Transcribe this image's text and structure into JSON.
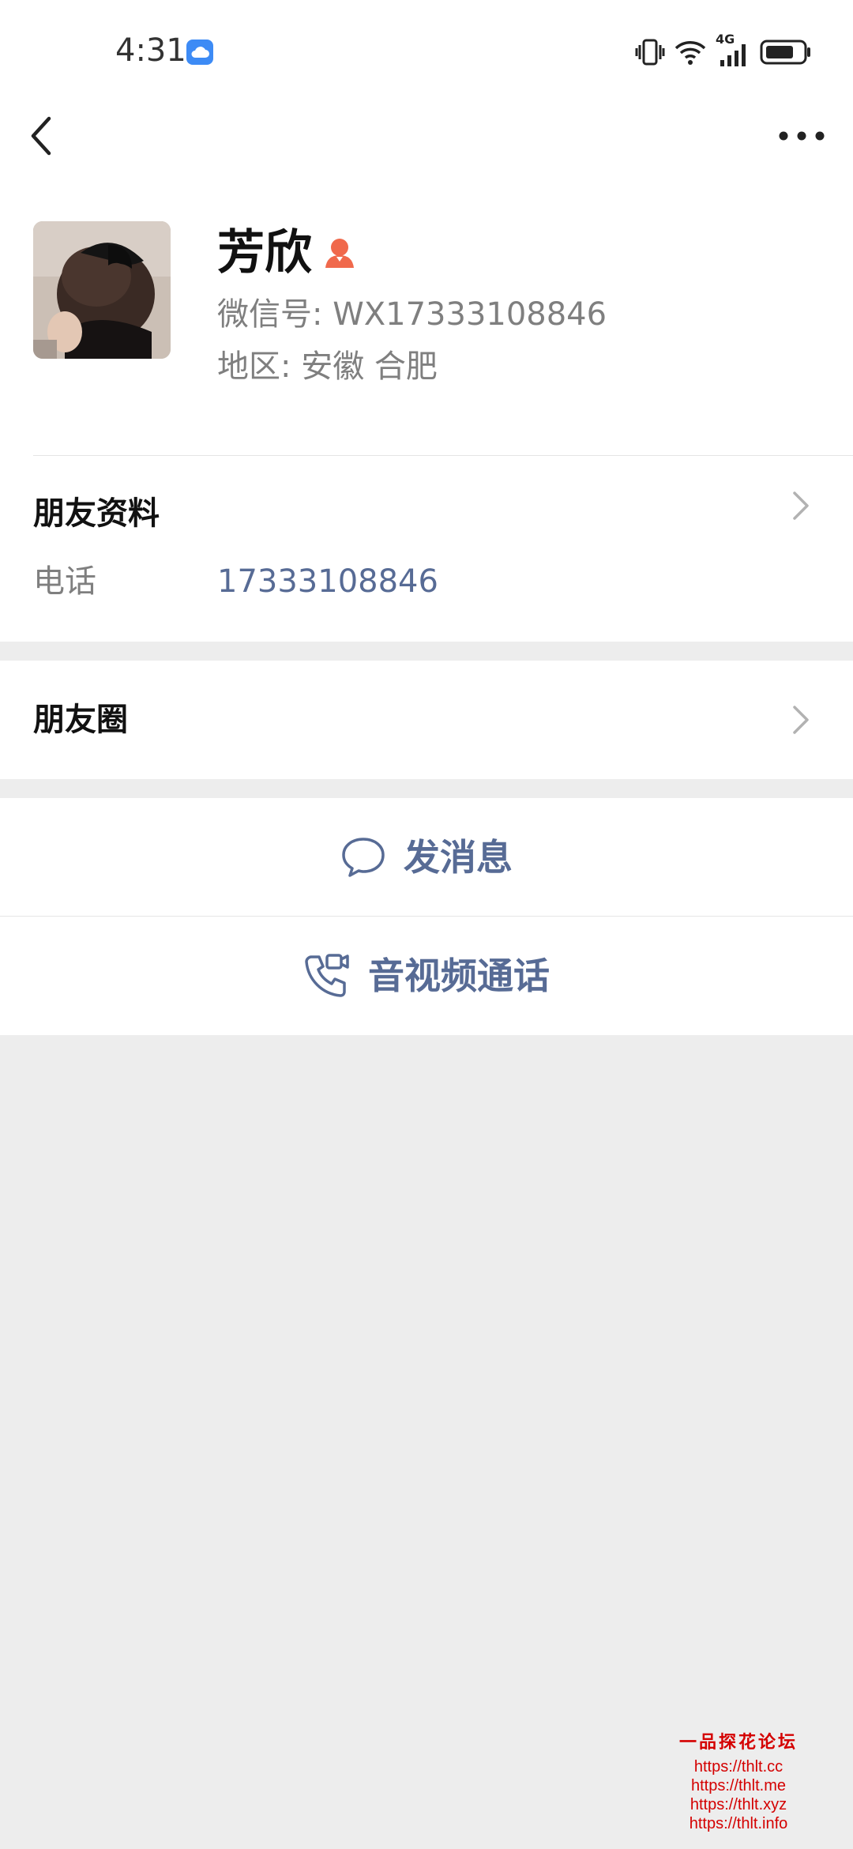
{
  "status_bar": {
    "time": "4:31",
    "network": "4G",
    "icons": [
      "cloud-app-icon",
      "vibrate-icon",
      "wifi-icon",
      "signal-icon",
      "battery-icon"
    ]
  },
  "header": {
    "back_icon": "chevron-left-icon",
    "more_icon": "more-dots-icon"
  },
  "profile": {
    "name": "芳欣",
    "gender_icon": "female-icon",
    "wechat_id": "微信号: WX17333108846",
    "region": "地区: 安徽  合肥"
  },
  "friend_info": {
    "title": "朋友资料",
    "phone_label": "电话",
    "phone_value": "17333108846"
  },
  "moments": {
    "title": "朋友圈"
  },
  "actions": {
    "message": "发消息",
    "call": "音视频通话"
  },
  "watermark": {
    "title": "一品探花论坛",
    "lines": [
      "https://thlt.cc",
      "https://thlt.me",
      "https://thlt.xyz",
      "https://thlt.info"
    ]
  },
  "colors": {
    "link": "#576b95",
    "background": "#ededed",
    "female_icon": "#f0694c",
    "watermark": "#d40000"
  }
}
